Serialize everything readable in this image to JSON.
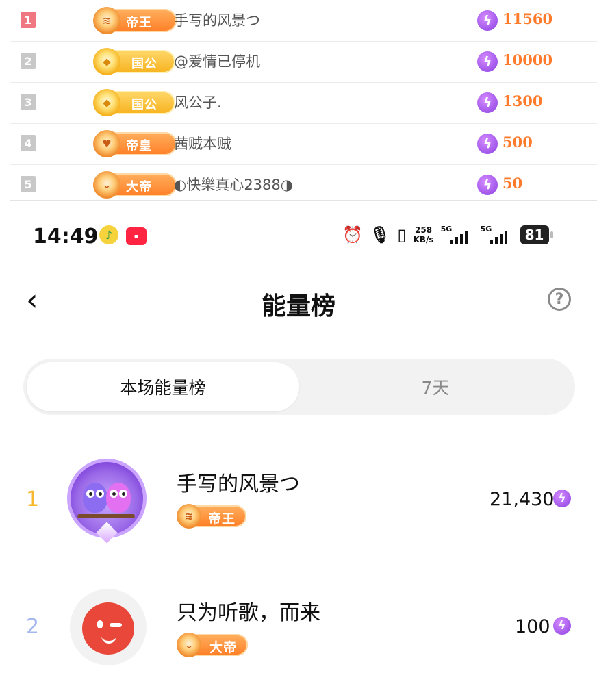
{
  "top_list": {
    "rows": [
      {
        "rank": "1",
        "title": "帝王",
        "title_icon": "crown-chevrons-icon",
        "name": "手写的风景つ",
        "score": "11560"
      },
      {
        "rank": "2",
        "title": "国公",
        "title_icon": "gold-gem-icon",
        "name": "@爱情已停机",
        "score": "10000"
      },
      {
        "rank": "3",
        "title": "国公",
        "title_icon": "gold-gem-icon",
        "name": "风公子.",
        "score": "1300"
      },
      {
        "rank": "4",
        "title": "帝皇",
        "title_icon": "heart-shield-icon",
        "name": "茜贼本贼",
        "score": "500"
      },
      {
        "rank": "5",
        "title": "大帝",
        "title_icon": "chevron-down-icon",
        "name": "◐快樂真心2388◑",
        "score": "50"
      }
    ]
  },
  "status_bar": {
    "time": "14:49",
    "net_speed_value": "258",
    "net_speed_unit": "KB/s",
    "sim1": "5G",
    "sim2": "5G",
    "battery": "81"
  },
  "header": {
    "title": "能量榜",
    "help_glyph": "?"
  },
  "tabs": [
    {
      "label": "本场能量榜",
      "active": true
    },
    {
      "label": "7天",
      "active": false
    }
  ],
  "ranking": [
    {
      "rank": "1",
      "name": "手写的风景つ",
      "title": "帝王",
      "score": "21,430",
      "rank_color": "#f5b82e"
    },
    {
      "rank": "2",
      "name": "只为听歌，而来",
      "title": "大帝",
      "score": "100",
      "rank_color": "#a6b7ef"
    }
  ],
  "colors": {
    "accent_orange": "#ff7a2a",
    "energy_purple": "#8a3fe0",
    "first_rank_red": "#ef7782"
  }
}
